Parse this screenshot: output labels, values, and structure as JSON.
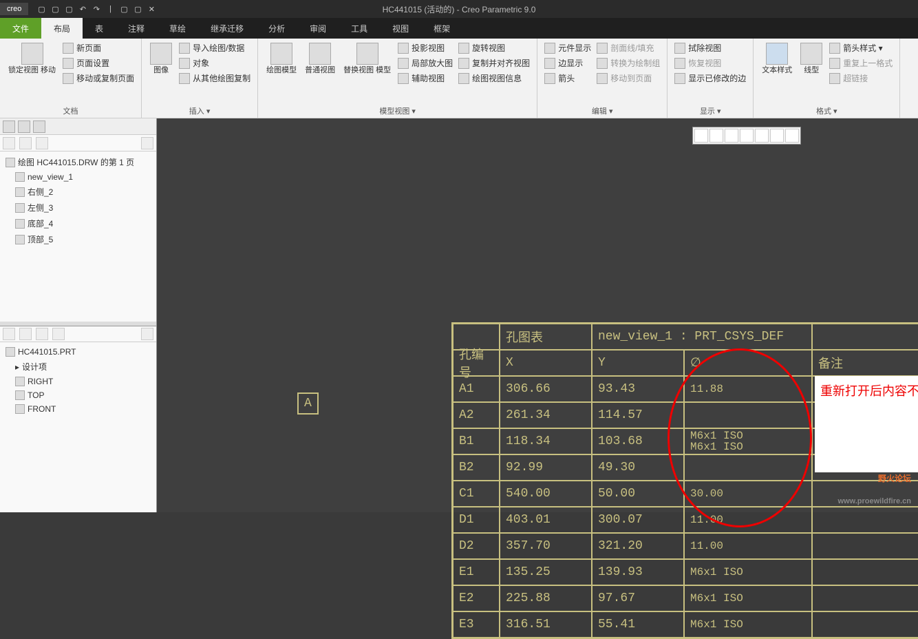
{
  "title": "HC441015 (活动的) - Creo Parametric 9.0",
  "logo": "creo",
  "menu": {
    "file": "文件",
    "tabs": [
      "布局",
      "表",
      "注释",
      "草绘",
      "继承迁移",
      "分析",
      "审阅",
      "工具",
      "视图",
      "框架"
    ]
  },
  "ribbon": {
    "g1": {
      "label": "文档",
      "big": "锁定视图\n移动",
      "small": [
        "新页面",
        "页面设置",
        "移动或复制页面"
      ]
    },
    "g2": {
      "label": "插入 ▾",
      "big": "图像",
      "small": [
        "导入绘图/数据",
        "对象",
        "从其他绘图复制"
      ]
    },
    "g3": {
      "label": "模型视图 ▾",
      "big": [
        "绘图模型",
        "普通视图",
        "替换视图\n模型"
      ],
      "small": [
        "投影视图",
        "旋转视图",
        "局部放大图",
        "复制并对齐视图",
        "辅助视图",
        "绘图视图信息"
      ]
    },
    "g4": {
      "label": "编辑 ▾",
      "small": [
        "元件显示",
        "剖面线/填充",
        "边显示",
        "转换为绘制组",
        "箭头",
        "移动到页面"
      ]
    },
    "g5": {
      "label": "显示 ▾",
      "small": [
        "拭除视图",
        "恢复视图",
        "显示已修改的边"
      ]
    },
    "g6": {
      "label": "格式 ▾",
      "big": [
        "文本样式",
        "线型"
      ],
      "small": [
        "箭头样式 ▾",
        "重复上一格式",
        "超链接"
      ]
    }
  },
  "tree1": {
    "root": "绘图 HC441015.DRW 的第 1 页",
    "items": [
      "new_view_1",
      "右侧_2",
      "左侧_3",
      "底部_4",
      "顶部_5"
    ]
  },
  "tree2": {
    "root": "HC441015.PRT",
    "items": [
      "设计项",
      "RIGHT",
      "TOP",
      "FRONT"
    ]
  },
  "labelA": "A",
  "tbl": {
    "hdr1": [
      "",
      "孔图表",
      "new_view_1 : PRT_CSYS_DEF",
      ""
    ],
    "hdr2": [
      "孔编号",
      "X",
      "Y",
      "∅",
      "备注"
    ],
    "rows": [
      [
        "A1",
        "306.66",
        "93.43",
        "11.88",
        ""
      ],
      [
        "A2",
        "261.34",
        "114.57",
        "",
        ""
      ],
      [
        "B1",
        "118.34",
        "103.68",
        "M6x1 ISO\nM6x1 ISO",
        ""
      ],
      [
        "B2",
        "92.99",
        "49.30",
        "",
        ""
      ],
      [
        "C1",
        "540.00",
        "50.00",
        "30.00",
        ""
      ],
      [
        "D1",
        "403.01",
        "300.07",
        "11.00",
        ""
      ],
      [
        "D2",
        "357.70",
        "321.20",
        "11.00",
        ""
      ],
      [
        "E1",
        "135.25",
        "139.93",
        "M6x1 ISO",
        ""
      ],
      [
        "E2",
        "225.88",
        "97.67",
        "M6x1 ISO",
        ""
      ],
      [
        "E3",
        "316.51",
        "55.41",
        "M6x1 ISO",
        ""
      ]
    ]
  },
  "annotation": "重新打开后内容不对",
  "watermark": {
    "main": "野火论坛",
    "sub": "www.proewildfire.cn"
  }
}
